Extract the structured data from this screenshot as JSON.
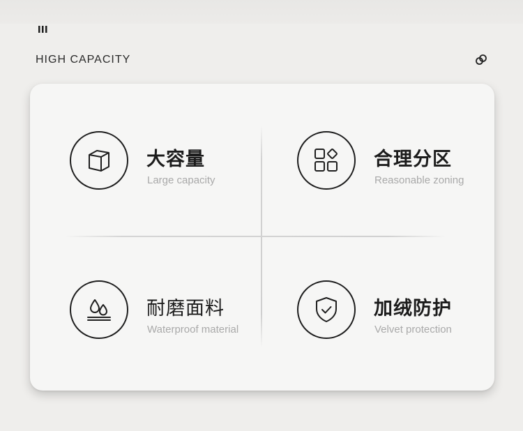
{
  "header": {
    "title": "HIGH CAPACITY"
  },
  "features": [
    {
      "icon": "cube-icon",
      "title": "大容量",
      "subtitle": "Large capacity"
    },
    {
      "icon": "zoning-icon",
      "title": "合理分区",
      "subtitle": "Reasonable zoning"
    },
    {
      "icon": "water-drop-icon",
      "title": "耐磨面料",
      "subtitle": "Waterproof material"
    },
    {
      "icon": "shield-check-icon",
      "title": "加绒防护",
      "subtitle": "Velvet protection"
    }
  ],
  "colors": {
    "background": "#efeeec",
    "card": "#f6f6f5",
    "icon_stroke": "#1e1e1e",
    "subtitle": "#a9a9a9"
  }
}
